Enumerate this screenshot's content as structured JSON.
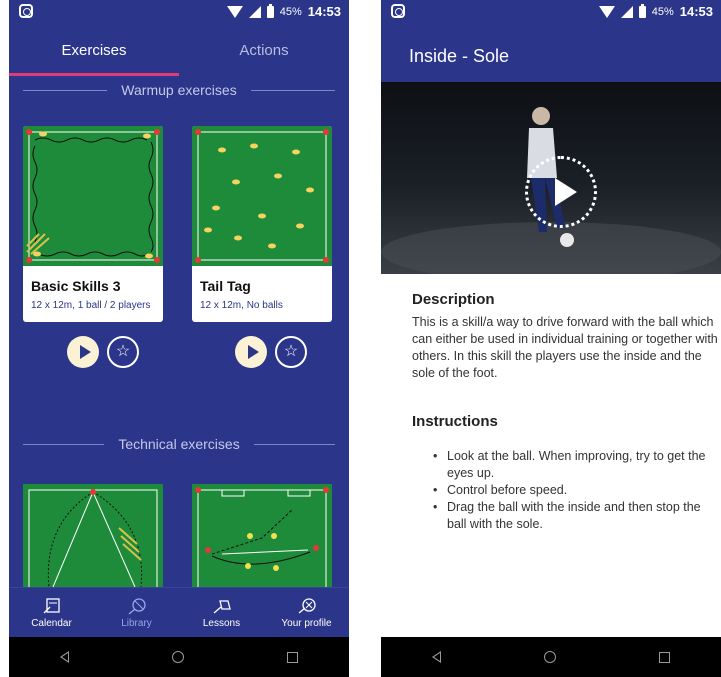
{
  "left_phone": {
    "status": {
      "battery": "45%",
      "time": "14:53"
    },
    "tabs": [
      {
        "label": "Exercises"
      },
      {
        "label": "Actions"
      }
    ],
    "sections": [
      {
        "title": "Warmup exercises"
      },
      {
        "title": "Technical exercises"
      }
    ],
    "cards": [
      {
        "title": "Basic Skills 3",
        "subtitle": "12 x 12m, 1 ball / 2 players"
      },
      {
        "title": "Tail Tag",
        "subtitle": "12 x 12m, No balls"
      }
    ],
    "favorite_glyph": "☆",
    "bottom_nav": [
      {
        "label": "Calendar",
        "icon": "calendar-icon"
      },
      {
        "label": "Library",
        "icon": "library-icon"
      },
      {
        "label": "Lessons",
        "icon": "lessons-icon"
      },
      {
        "label": "Your profile",
        "icon": "profile-icon"
      }
    ],
    "colors": {
      "background": "#2b3589",
      "tab_indicator": "#e03a7a",
      "field": "#1e8b3b"
    }
  },
  "right_phone": {
    "status": {
      "battery": "45%",
      "time": "14:53"
    },
    "title": "Inside - Sole",
    "description_heading": "Description",
    "description": "This is a skill/a way to drive forward with the ball which can either be used in individual training or together with others. In this skill the players use the inside and the sole of the foot.",
    "instructions_heading": "Instructions",
    "instructions": [
      "Look at the ball. When improving, try to get the eyes up.",
      "Control before speed.",
      "Drag the ball with the inside and then stop the ball with the sole."
    ]
  }
}
